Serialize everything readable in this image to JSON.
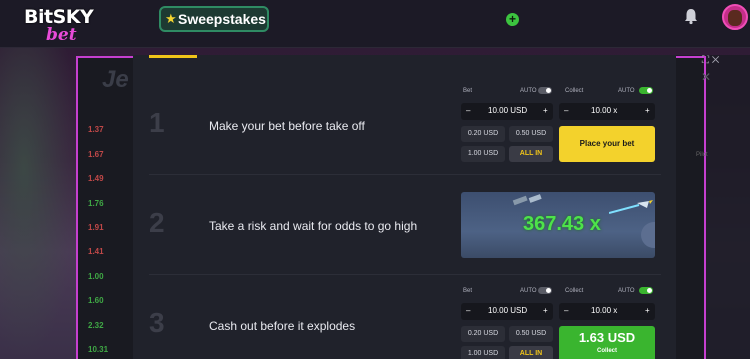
{
  "header": {
    "logo_top": "BitSKY",
    "logo_bottom": "bet",
    "sweepstakes_label": "Sweepstakes"
  },
  "game": {
    "title_partial": "Je",
    "history": [
      "1.37",
      "1.67",
      "1.49",
      "1.76",
      "1.91",
      "1.41",
      "1.00",
      "1.60",
      "2.32",
      "10.31"
    ],
    "side_text": "Pilot"
  },
  "steps": [
    {
      "num": "1",
      "text": "Make your bet before take off"
    },
    {
      "num": "2",
      "text": "Take a risk and wait for odds to go high"
    },
    {
      "num": "3",
      "text": "Cash out before it explodes"
    }
  ],
  "panel1": {
    "bet_label": "Bet",
    "auto_label": "AUTO",
    "collect_label": "Collect",
    "auto2_label": "AUTO",
    "bet_value": "10.00 USD",
    "collect_value": "10.00 x",
    "minus": "–",
    "plus": "+",
    "quick": [
      "0.20 USD",
      "0.50 USD",
      "1.00 USD",
      "ALL IN"
    ],
    "action_label": "Place your bet"
  },
  "panel3": {
    "bet_label": "Bet",
    "auto_label": "AUTO",
    "collect_label": "Collect",
    "auto2_label": "AUTO",
    "bet_value": "10.00 USD",
    "collect_value": "10.00 x",
    "minus": "–",
    "plus": "+",
    "quick": [
      "0.20 USD",
      "0.50 USD",
      "1.00 USD",
      "ALL IN"
    ],
    "collect_amount": "1.63 USD",
    "collect_sub": "Collect"
  },
  "preview": {
    "odds": "367.43 x"
  },
  "colors": {
    "accent": "#f0c419",
    "green": "#3ab52f",
    "toggle_on": "#3ab52f",
    "toggle_off": "#5a5c66"
  }
}
